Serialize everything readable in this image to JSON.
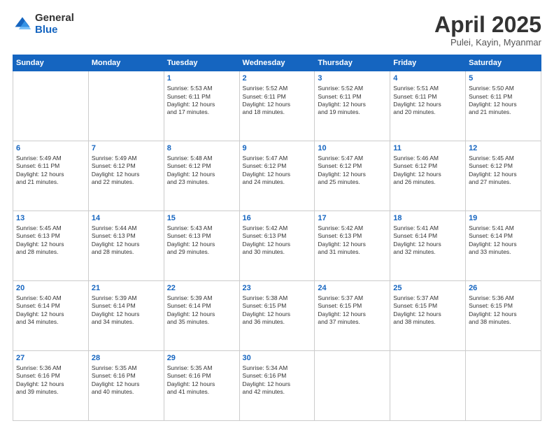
{
  "logo": {
    "general": "General",
    "blue": "Blue"
  },
  "header": {
    "title": "April 2025",
    "subtitle": "Pulei, Kayin, Myanmar"
  },
  "weekdays": [
    "Sunday",
    "Monday",
    "Tuesday",
    "Wednesday",
    "Thursday",
    "Friday",
    "Saturday"
  ],
  "weeks": [
    [
      {
        "day": "",
        "info": ""
      },
      {
        "day": "",
        "info": ""
      },
      {
        "day": "1",
        "info": "Sunrise: 5:53 AM\nSunset: 6:11 PM\nDaylight: 12 hours\nand 17 minutes."
      },
      {
        "day": "2",
        "info": "Sunrise: 5:52 AM\nSunset: 6:11 PM\nDaylight: 12 hours\nand 18 minutes."
      },
      {
        "day": "3",
        "info": "Sunrise: 5:52 AM\nSunset: 6:11 PM\nDaylight: 12 hours\nand 19 minutes."
      },
      {
        "day": "4",
        "info": "Sunrise: 5:51 AM\nSunset: 6:11 PM\nDaylight: 12 hours\nand 20 minutes."
      },
      {
        "day": "5",
        "info": "Sunrise: 5:50 AM\nSunset: 6:11 PM\nDaylight: 12 hours\nand 21 minutes."
      }
    ],
    [
      {
        "day": "6",
        "info": "Sunrise: 5:49 AM\nSunset: 6:11 PM\nDaylight: 12 hours\nand 21 minutes."
      },
      {
        "day": "7",
        "info": "Sunrise: 5:49 AM\nSunset: 6:12 PM\nDaylight: 12 hours\nand 22 minutes."
      },
      {
        "day": "8",
        "info": "Sunrise: 5:48 AM\nSunset: 6:12 PM\nDaylight: 12 hours\nand 23 minutes."
      },
      {
        "day": "9",
        "info": "Sunrise: 5:47 AM\nSunset: 6:12 PM\nDaylight: 12 hours\nand 24 minutes."
      },
      {
        "day": "10",
        "info": "Sunrise: 5:47 AM\nSunset: 6:12 PM\nDaylight: 12 hours\nand 25 minutes."
      },
      {
        "day": "11",
        "info": "Sunrise: 5:46 AM\nSunset: 6:12 PM\nDaylight: 12 hours\nand 26 minutes."
      },
      {
        "day": "12",
        "info": "Sunrise: 5:45 AM\nSunset: 6:12 PM\nDaylight: 12 hours\nand 27 minutes."
      }
    ],
    [
      {
        "day": "13",
        "info": "Sunrise: 5:45 AM\nSunset: 6:13 PM\nDaylight: 12 hours\nand 28 minutes."
      },
      {
        "day": "14",
        "info": "Sunrise: 5:44 AM\nSunset: 6:13 PM\nDaylight: 12 hours\nand 28 minutes."
      },
      {
        "day": "15",
        "info": "Sunrise: 5:43 AM\nSunset: 6:13 PM\nDaylight: 12 hours\nand 29 minutes."
      },
      {
        "day": "16",
        "info": "Sunrise: 5:42 AM\nSunset: 6:13 PM\nDaylight: 12 hours\nand 30 minutes."
      },
      {
        "day": "17",
        "info": "Sunrise: 5:42 AM\nSunset: 6:13 PM\nDaylight: 12 hours\nand 31 minutes."
      },
      {
        "day": "18",
        "info": "Sunrise: 5:41 AM\nSunset: 6:14 PM\nDaylight: 12 hours\nand 32 minutes."
      },
      {
        "day": "19",
        "info": "Sunrise: 5:41 AM\nSunset: 6:14 PM\nDaylight: 12 hours\nand 33 minutes."
      }
    ],
    [
      {
        "day": "20",
        "info": "Sunrise: 5:40 AM\nSunset: 6:14 PM\nDaylight: 12 hours\nand 34 minutes."
      },
      {
        "day": "21",
        "info": "Sunrise: 5:39 AM\nSunset: 6:14 PM\nDaylight: 12 hours\nand 34 minutes."
      },
      {
        "day": "22",
        "info": "Sunrise: 5:39 AM\nSunset: 6:14 PM\nDaylight: 12 hours\nand 35 minutes."
      },
      {
        "day": "23",
        "info": "Sunrise: 5:38 AM\nSunset: 6:15 PM\nDaylight: 12 hours\nand 36 minutes."
      },
      {
        "day": "24",
        "info": "Sunrise: 5:37 AM\nSunset: 6:15 PM\nDaylight: 12 hours\nand 37 minutes."
      },
      {
        "day": "25",
        "info": "Sunrise: 5:37 AM\nSunset: 6:15 PM\nDaylight: 12 hours\nand 38 minutes."
      },
      {
        "day": "26",
        "info": "Sunrise: 5:36 AM\nSunset: 6:15 PM\nDaylight: 12 hours\nand 38 minutes."
      }
    ],
    [
      {
        "day": "27",
        "info": "Sunrise: 5:36 AM\nSunset: 6:16 PM\nDaylight: 12 hours\nand 39 minutes."
      },
      {
        "day": "28",
        "info": "Sunrise: 5:35 AM\nSunset: 6:16 PM\nDaylight: 12 hours\nand 40 minutes."
      },
      {
        "day": "29",
        "info": "Sunrise: 5:35 AM\nSunset: 6:16 PM\nDaylight: 12 hours\nand 41 minutes."
      },
      {
        "day": "30",
        "info": "Sunrise: 5:34 AM\nSunset: 6:16 PM\nDaylight: 12 hours\nand 42 minutes."
      },
      {
        "day": "",
        "info": ""
      },
      {
        "day": "",
        "info": ""
      },
      {
        "day": "",
        "info": ""
      }
    ]
  ]
}
